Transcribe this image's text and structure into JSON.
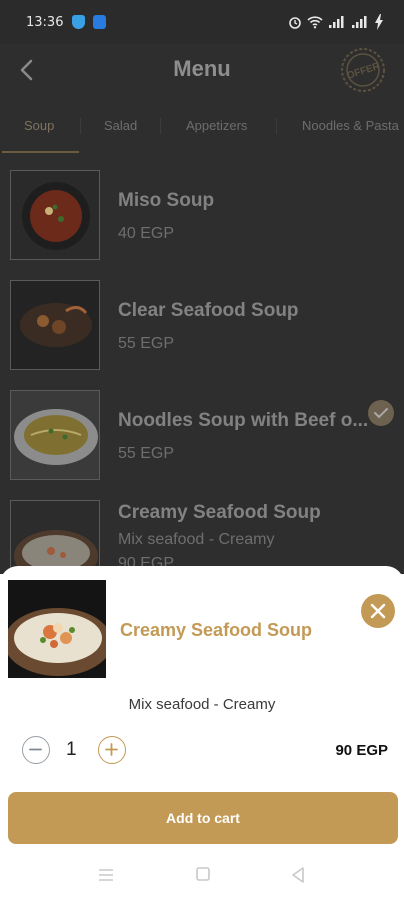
{
  "status_bar": {
    "time": "13:36"
  },
  "header": {
    "title": "Menu",
    "offer_badge": "OFFER"
  },
  "tabs": [
    {
      "label": "Soup",
      "active": true
    },
    {
      "label": "Salad",
      "active": false
    },
    {
      "label": "Appetizers",
      "active": false
    },
    {
      "label": "Noodles & Pasta",
      "active": false
    }
  ],
  "menu_items": [
    {
      "name": "Miso Soup",
      "price": "40 EGP"
    },
    {
      "name": "Clear Seafood Soup",
      "price": "55 EGP"
    },
    {
      "name": "Noodles Soup with Beef o...",
      "price": "55 EGP",
      "selected": true
    },
    {
      "name": "Creamy Seafood Soup",
      "description": "Mix seafood - Creamy",
      "price": "90 EGP"
    }
  ],
  "sheet": {
    "name": "Creamy Seafood Soup",
    "description": "Mix seafood - Creamy",
    "quantity": "1",
    "total": "90 EGP",
    "add_label": "Add to cart"
  },
  "colors": {
    "accent": "#c39a55",
    "overlay": "#2e2e2e"
  }
}
